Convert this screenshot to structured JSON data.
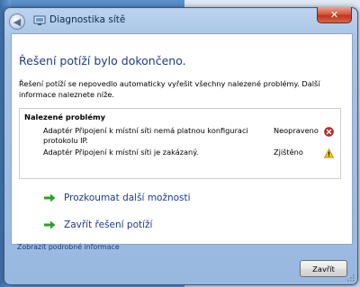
{
  "window": {
    "title": "Diagnostika sítě",
    "close_glyph": "✕"
  },
  "main": {
    "heading": "Řešení potíží bylo dokončeno.",
    "description": "Řešení potíží se nepovedlo automaticky vyřešit všechny nalezené problémy. Další informace naleznete níže.",
    "problems": {
      "header": "Nalezené problémy",
      "rows": [
        {
          "text": "Adaptér Připojení k místní síti nemá platnou konfiguraci protokolu IP.",
          "status": "Neopraveno",
          "icon": "error-icon"
        },
        {
          "text": "Adaptér Připojení k místní síti je zakázaný.",
          "status": "Zjištěno",
          "icon": "warning-icon"
        }
      ]
    },
    "tasks": [
      {
        "label": "Prozkoumat další možnosti",
        "icon": "green-arrow-icon"
      },
      {
        "label": "Zavřít řešení potíží",
        "icon": "green-arrow-icon"
      }
    ],
    "details_link": "Zobrazit podrobné informace"
  },
  "footer": {
    "close_button": "Zavřít"
  },
  "colors": {
    "link": "#1e3a8a",
    "error": "#c62828",
    "warning": "#f2c200",
    "arrow": "#2e9e2e"
  }
}
